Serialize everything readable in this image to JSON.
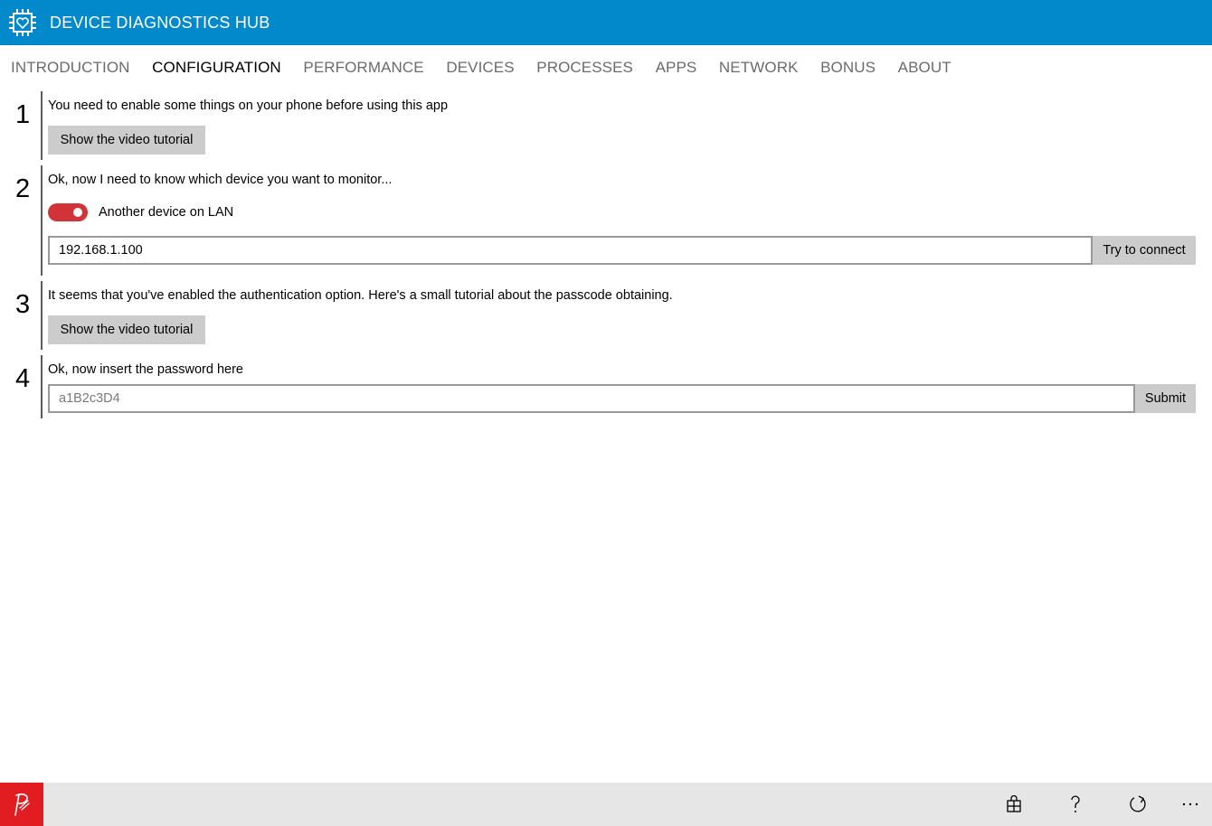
{
  "window": {
    "title": "DEVICE DIAGNOSTICS HUB",
    "accent": "#0289cc"
  },
  "nav": {
    "items": [
      {
        "label": "INTRODUCTION",
        "active": false
      },
      {
        "label": "CONFIGURATION",
        "active": true
      },
      {
        "label": "PERFORMANCE",
        "active": false
      },
      {
        "label": "DEVICES",
        "active": false
      },
      {
        "label": "PROCESSES",
        "active": false
      },
      {
        "label": "APPS",
        "active": false
      },
      {
        "label": "NETWORK",
        "active": false
      },
      {
        "label": "BONUS",
        "active": false
      },
      {
        "label": "ABOUT",
        "active": false
      }
    ]
  },
  "steps": {
    "s1": {
      "number": "1",
      "text": "You need to enable some things on your phone before using this app",
      "button": "Show the video tutorial"
    },
    "s2": {
      "number": "2",
      "text": "Ok, now I need to know which device you want to monitor...",
      "toggle_label": "Another device on LAN",
      "toggle_on": true,
      "address_value": "192.168.1.100",
      "connect_button": "Try to connect"
    },
    "s3": {
      "number": "3",
      "text": "It seems that you've enabled the authentication option. Here's a small tutorial about the passcode obtaining.",
      "button": "Show the video tutorial"
    },
    "s4": {
      "number": "4",
      "text": "Ok, now insert the password here",
      "password_placeholder": "a1B2c3D4",
      "submit_button": "Submit"
    }
  },
  "bottombar": {
    "icons": [
      "store-icon",
      "help-icon",
      "refresh-icon",
      "more-icon"
    ],
    "brand_color": "#e11d22"
  }
}
